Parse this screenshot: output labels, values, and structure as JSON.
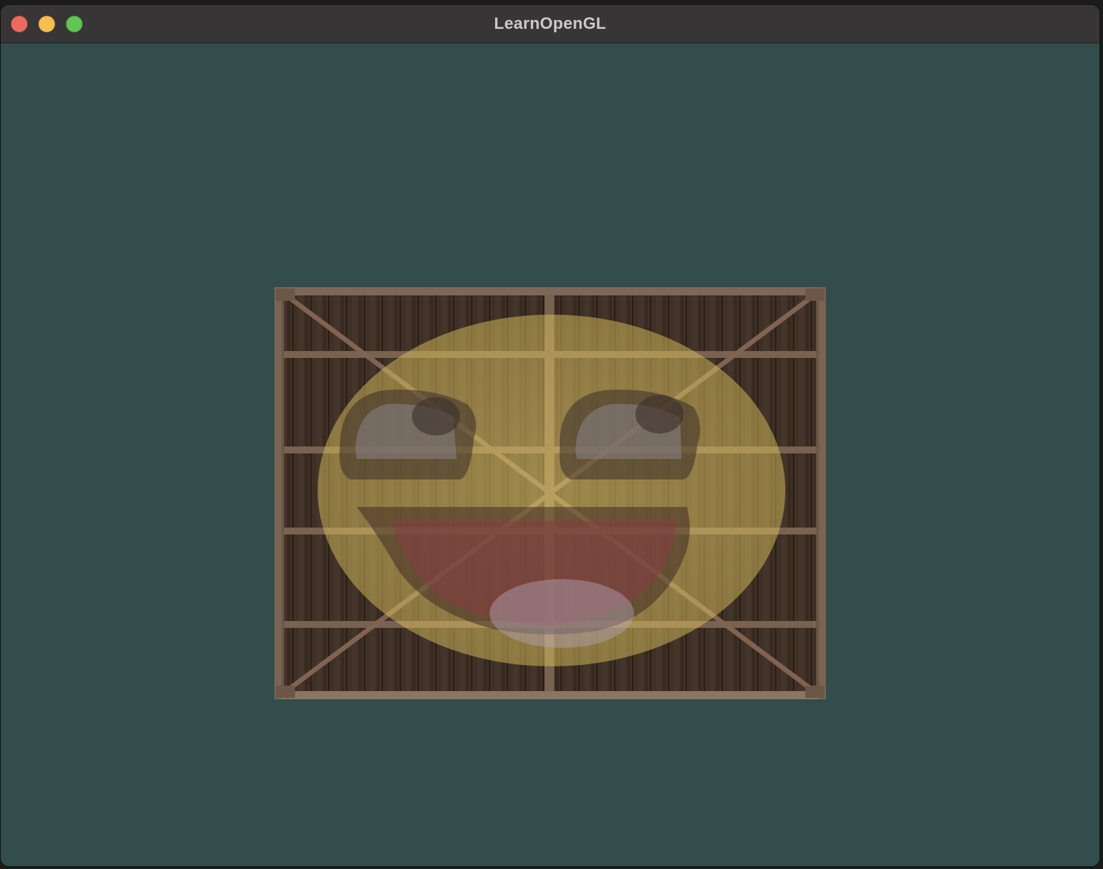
{
  "window": {
    "title": "LearnOpenGL",
    "clear_color": "#334c4c"
  },
  "traffic_lights": [
    {
      "name": "close",
      "color": "#ed6a5e"
    },
    {
      "name": "minimize",
      "color": "#f5bf4f"
    },
    {
      "name": "maximize",
      "color": "#61c554"
    }
  ],
  "render": {
    "textures": [
      "wooden-container",
      "awesomeface"
    ],
    "blend": "mix"
  }
}
